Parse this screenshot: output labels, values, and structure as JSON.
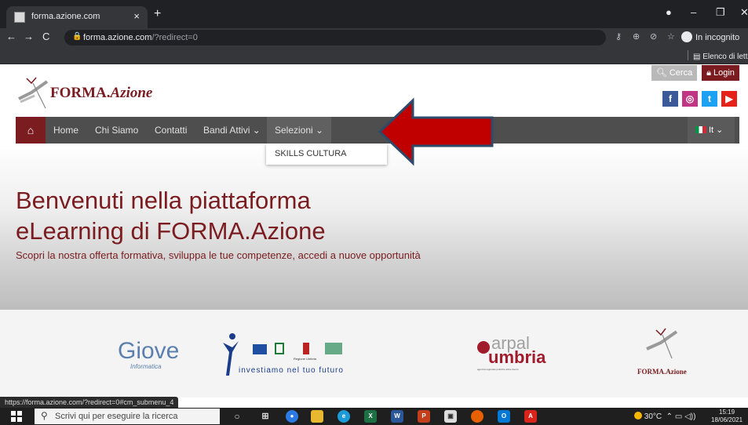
{
  "browser": {
    "tab_title": "forma.azione.com",
    "tab_close": "×",
    "new_tab": "+",
    "url_host": "forma.azione.com",
    "url_path": "/?redirect=0",
    "incognito_label": "In incognito",
    "reading_list": "Elenco di lettura",
    "status_url": "https://forma.azione.com/?redirect=0#cm_submenu_4"
  },
  "header": {
    "brand_main": "FORMA.",
    "brand_italic": "Azione",
    "cerca_label": "Cerca",
    "login_label": "Login",
    "social": [
      "f",
      "◎",
      "t",
      "▶"
    ]
  },
  "nav": {
    "items": [
      "Home",
      "Chi Siamo",
      "Contatti",
      "Bandi Attivi ⌄",
      "Selezioni ⌄"
    ],
    "lang": "It ⌄",
    "dropdown_item": "SKILLS CULTURA"
  },
  "hero": {
    "title_line1": "Benvenuti nella piattaforma",
    "title_line2": "eLearning di FORMA.Azione",
    "subtitle": "Scopri la nostra offerta formativa, sviluppa le tue competenze, accedi a nuove opportunità"
  },
  "partners": {
    "giove": "Giove",
    "giove_sub": "Informatica",
    "fse_text": "investiamo nel tuo futuro",
    "fse_regione": "Regione Umbria",
    "arpal": "arpal",
    "umbria": "umbria",
    "arpal_sub": "agenzia regionale politiche attive lavoro",
    "forma_logo": "FORMA.Azione"
  },
  "taskbar": {
    "search_placeholder": "Scrivi qui per eseguire la ricerca",
    "temperature": "30°C",
    "time": "15:19",
    "date": "18/06/2021"
  },
  "colors": {
    "brand": "#7a1c20",
    "nav_bg": "#4e4e4e",
    "arrow": "#c00000"
  }
}
